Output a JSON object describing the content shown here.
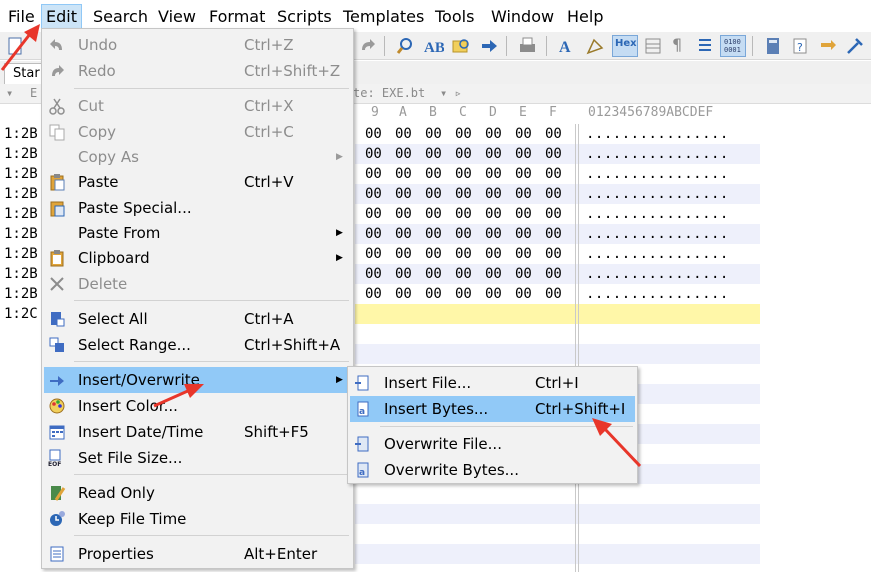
{
  "menubar": {
    "items": [
      "File",
      "Edit",
      "Search",
      "View",
      "Format",
      "Scripts",
      "Templates",
      "Tools",
      "Window",
      "Help"
    ]
  },
  "tabs": {
    "start_label": "Star"
  },
  "editor_header": {
    "file_label": "te: EXE.bt",
    "left_marker": "E"
  },
  "hex_header": {
    "columns": [
      "9",
      "A",
      "B",
      "C",
      "D",
      "E",
      "F"
    ],
    "ascii_header": "0123456789ABCDEF"
  },
  "hex_rows": [
    {
      "addr": "1:2B",
      "bytes": [
        "00",
        "00",
        "00",
        "00",
        "00",
        "00",
        "00"
      ],
      "ascii": "................"
    },
    {
      "addr": "1:2B",
      "bytes": [
        "00",
        "00",
        "00",
        "00",
        "00",
        "00",
        "00"
      ],
      "ascii": "................"
    },
    {
      "addr": "1:2B",
      "bytes": [
        "00",
        "00",
        "00",
        "00",
        "00",
        "00",
        "00"
      ],
      "ascii": "................"
    },
    {
      "addr": "1:2B",
      "bytes": [
        "00",
        "00",
        "00",
        "00",
        "00",
        "00",
        "00"
      ],
      "ascii": "................"
    },
    {
      "addr": "1:2B",
      "bytes": [
        "00",
        "00",
        "00",
        "00",
        "00",
        "00",
        "00"
      ],
      "ascii": "................"
    },
    {
      "addr": "1:2B",
      "bytes": [
        "00",
        "00",
        "00",
        "00",
        "00",
        "00",
        "00"
      ],
      "ascii": "................"
    },
    {
      "addr": "1:2B",
      "bytes": [
        "00",
        "00",
        "00",
        "00",
        "00",
        "00",
        "00"
      ],
      "ascii": "................"
    },
    {
      "addr": "1:2B",
      "bytes": [
        "00",
        "00",
        "00",
        "00",
        "00",
        "00",
        "00"
      ],
      "ascii": "................"
    },
    {
      "addr": "1:2B",
      "bytes": [
        "00",
        "00",
        "00",
        "00",
        "00",
        "00",
        "00"
      ],
      "ascii": "................"
    },
    {
      "addr": "1:2C",
      "bytes": [],
      "ascii": ""
    }
  ],
  "edit_menu": {
    "items": [
      {
        "label": "Undo",
        "shortcut": "Ctrl+Z",
        "disabled": true,
        "icon": "undo-icon"
      },
      {
        "label": "Redo",
        "shortcut": "Ctrl+Shift+Z",
        "disabled": true,
        "icon": "redo-icon"
      },
      {
        "label": "Cut",
        "shortcut": "Ctrl+X",
        "disabled": true,
        "icon": "scissors-icon"
      },
      {
        "label": "Copy",
        "shortcut": "Ctrl+C",
        "disabled": true,
        "icon": "copy-icon"
      },
      {
        "label": "Copy As",
        "shortcut": "",
        "disabled": true,
        "icon": ""
      },
      {
        "label": "Paste",
        "shortcut": "Ctrl+V",
        "disabled": false,
        "icon": "paste-icon"
      },
      {
        "label": "Paste Special...",
        "shortcut": "",
        "disabled": false,
        "icon": "paste-special-icon"
      },
      {
        "label": "Paste From",
        "shortcut": "",
        "disabled": false,
        "icon": ""
      },
      {
        "label": "Clipboard",
        "shortcut": "",
        "disabled": false,
        "icon": "clipboard-icon"
      },
      {
        "label": "Delete",
        "shortcut": "",
        "disabled": true,
        "icon": "delete-x-icon"
      },
      {
        "label": "Select All",
        "shortcut": "Ctrl+A",
        "disabled": false,
        "icon": "select-all-icon"
      },
      {
        "label": "Select Range...",
        "shortcut": "Ctrl+Shift+A",
        "disabled": false,
        "icon": "select-range-icon"
      },
      {
        "label": "Insert/Overwrite",
        "shortcut": "",
        "disabled": false,
        "icon": "insert-overwrite-icon"
      },
      {
        "label": "Insert Color...",
        "shortcut": "",
        "disabled": false,
        "icon": "palette-icon"
      },
      {
        "label": "Insert Date/Time",
        "shortcut": "Shift+F5",
        "disabled": false,
        "icon": "calendar-icon"
      },
      {
        "label": "Set File Size...",
        "shortcut": "",
        "disabled": false,
        "icon": "eof-icon"
      },
      {
        "label": "Read Only",
        "shortcut": "",
        "disabled": false,
        "icon": "read-only-icon"
      },
      {
        "label": "Keep File Time",
        "shortcut": "",
        "disabled": false,
        "icon": "keep-time-icon"
      },
      {
        "label": "Properties",
        "shortcut": "Alt+Enter",
        "disabled": false,
        "icon": "properties-icon"
      }
    ]
  },
  "submenu": {
    "items": [
      {
        "label": "Insert File...",
        "shortcut": "Ctrl+I",
        "icon": "insert-file-icon"
      },
      {
        "label": "Insert Bytes...",
        "shortcut": "Ctrl+Shift+I",
        "icon": "insert-bytes-icon"
      },
      {
        "label": "Overwrite File...",
        "shortcut": "",
        "icon": "overwrite-file-icon"
      },
      {
        "label": "Overwrite Bytes...",
        "shortcut": "",
        "icon": "overwrite-bytes-icon"
      }
    ]
  },
  "toolbar": {
    "hex_label": "Hex",
    "binary_label_top": "0100",
    "binary_label_bottom": "0001"
  },
  "colors": {
    "highlight": "#91c9f7",
    "yellow_row": "#fff7a8",
    "stripe": "#eef0fb",
    "annotation_red": "#e8362a"
  }
}
